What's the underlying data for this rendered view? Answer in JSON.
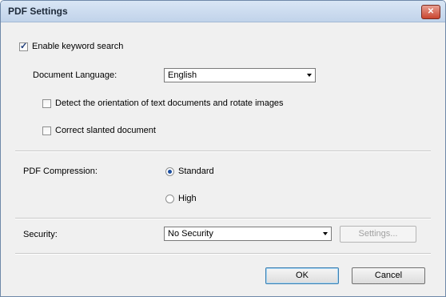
{
  "window": {
    "title": "PDF Settings",
    "close_label": "✕"
  },
  "keyword_search": {
    "label": "Enable keyword search",
    "checked": true
  },
  "document_language": {
    "label": "Document Language:",
    "value": "English"
  },
  "detect_orientation": {
    "label": "Detect the orientation of text documents and rotate images",
    "checked": false
  },
  "correct_slanted": {
    "label": "Correct slanted document",
    "checked": false
  },
  "compression": {
    "label": "PDF Compression:",
    "options": [
      {
        "label": "Standard",
        "selected": true
      },
      {
        "label": "High",
        "selected": false
      }
    ]
  },
  "security": {
    "label": "Security:",
    "value": "No Security",
    "settings_button": "Settings..."
  },
  "buttons": {
    "ok": "OK",
    "cancel": "Cancel"
  },
  "icons": {
    "check": "✓",
    "close": "close-icon",
    "dropdown": "chevron-down-icon"
  }
}
